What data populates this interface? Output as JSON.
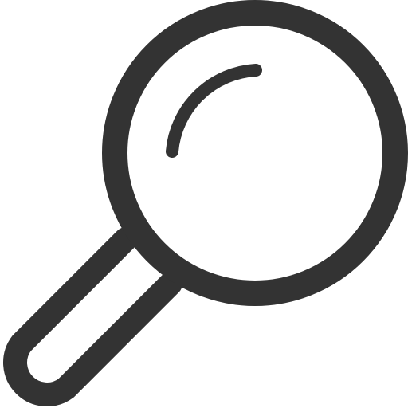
{
  "icon": {
    "name": "search-icon",
    "stroke_color": "#333333",
    "background_color": "#ffffff"
  }
}
